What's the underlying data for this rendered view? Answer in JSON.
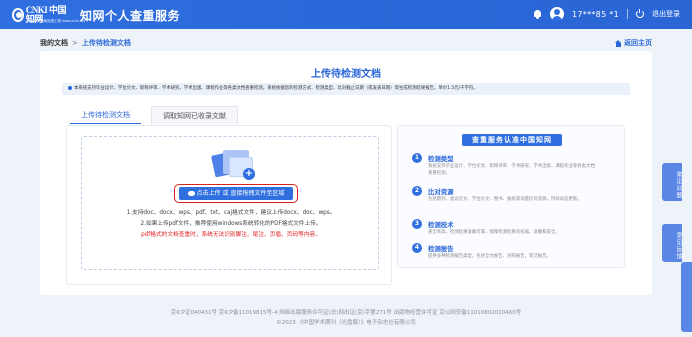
{
  "header": {
    "logo_text": "CNKI 中国知网",
    "logo_sub": "中国知识基础设施工程 www.cnki.net",
    "title": "知网个人查重服务",
    "user_id": "17***85 *1",
    "logout": "退出登录"
  },
  "breadcrumb": {
    "home": "我的文档",
    "separator": ">",
    "current": "上传待检测文档",
    "back": "返回主页"
  },
  "main": {
    "title": "上传待检测文档",
    "notice": "本系统支持毕业设计、学位论文、职称评审、学术研究、学术出版、课程作业等各类文档查重检测，系统依据您的检测方式、检测类型、比对截止日期（或发表日期）等生成检测结果报告，单价1.5元/千字符。",
    "tabs": [
      {
        "label": "上传待检测文档"
      },
      {
        "label": "调取知网已收录文献"
      }
    ],
    "upload_button": "点击上传 或 直接拖拽文件至区域",
    "rules": [
      "1.支持doc、docx、wps、pdf、txt、caj格式文件，建议上传docx、doc、wps。",
      "2.如果上传pdf文件，推荐使用windows系统转化的PDF格式文件上传。",
      "pdf格式的文档查重时，系统无法识别脚注、尾注、页眉、页码等内容。"
    ]
  },
  "info_card": {
    "title": "查重服务认准中国知网",
    "items": [
      {
        "num": "1",
        "head": "检测类型",
        "desc": "系统支持毕业设计、学位论文、职称评审、学术研究、学术出版、课程作业等各类文档查重检测。"
      },
      {
        "num": "2",
        "head": "比对资源",
        "desc": "包括期刊、会议论文、学位论文、图书、报纸等海量比对资源，持续动态更新。"
      },
      {
        "num": "3",
        "head": "检测技术",
        "desc": "查全率高，检测结果准确可靠，保障检测结果的权威、准确和安全。"
      },
      {
        "num": "4",
        "head": "检测报告",
        "desc": "提供多种检测报告类型，包括全文报告、对照报告、简洁报告。"
      }
    ]
  },
  "side_tabs": {
    "faq": "常见问题",
    "feedback": "意见反馈"
  },
  "footer": {
    "line1": "京ICP证040431号 京ICP备11019815号-4 网络出版服务许可证(总)网出证(京)字第271号 出版物经营许可证 京公网安备11010802020460号",
    "line2": "©2023 《中国学术期刊（光盘版）》电子杂志社有限公司"
  }
}
